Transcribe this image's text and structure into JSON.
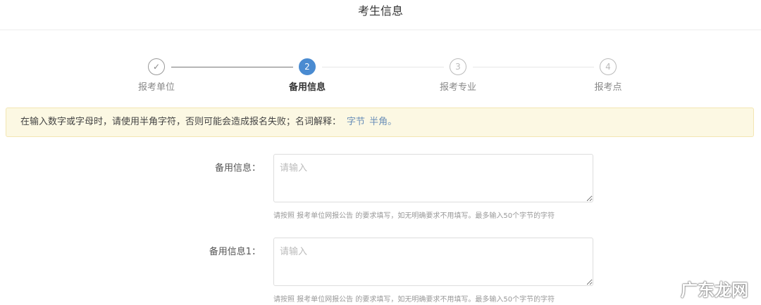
{
  "header": {
    "title": "考生信息"
  },
  "steps": [
    {
      "label": "报考单位",
      "icon": "✓",
      "state": "done"
    },
    {
      "label": "备用信息",
      "icon": "2",
      "state": "active"
    },
    {
      "label": "报考专业",
      "icon": "3",
      "state": "pending"
    },
    {
      "label": "报考点",
      "icon": "4",
      "state": "pending"
    }
  ],
  "alert": {
    "text": "在输入数字或字母时，请使用半角字符，否则可能会造成报名失败；名词解释：",
    "link1": "字节",
    "link2": "半角。"
  },
  "fields": [
    {
      "label": "备用信息：",
      "placeholder": "请输入",
      "value": "",
      "help": "请按照 报考单位网报公告 的要求填写，如无明确要求不用填写。最多输入50个字节的字符"
    },
    {
      "label": "备用信息1：",
      "placeholder": "请输入",
      "value": "",
      "help": "请按照 报考单位网报公告 的要求填写，如无明确要求不用填写。最多输入50个字节的字符"
    }
  ],
  "watermark": "广东龙网"
}
